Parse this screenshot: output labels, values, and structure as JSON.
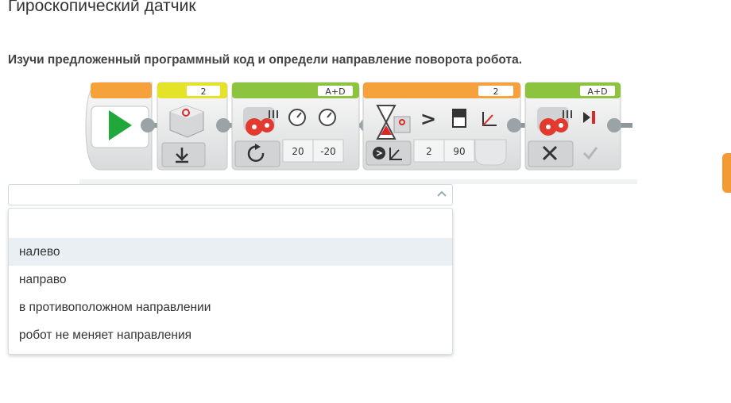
{
  "page": {
    "title": "Гироскопический датчик",
    "question": "Изучи предложенный программный код и определи направление поворота робота."
  },
  "program": {
    "wait_block_port": "2",
    "motor_block_ports": "A+D",
    "motor_speeds": [
      "20",
      "-20"
    ],
    "gyro_wait_port": "2",
    "gyro_compare_op": ">",
    "gyro_type": "2",
    "gyro_threshold": "90",
    "stop_block_ports": "A+D",
    "colors": {
      "start_orange": "#f6a23c",
      "sensor_yellow": "#e5e22a",
      "motor_green": "#8cc43f",
      "flow_green": "#20a83b",
      "block_gray": "#e9eaeb"
    }
  },
  "select": {
    "value": "",
    "options": [
      "",
      "налево",
      "направо",
      "в противоположном направлении",
      "робот не меняет направления"
    ]
  }
}
